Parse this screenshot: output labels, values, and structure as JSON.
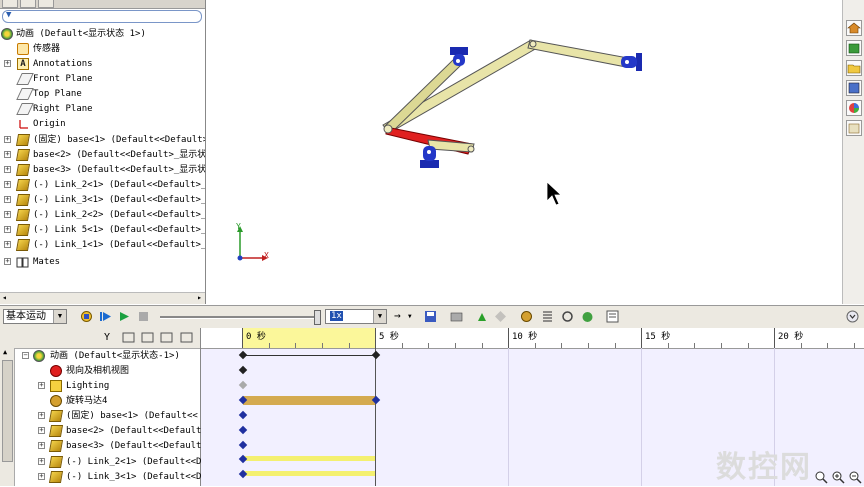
{
  "feature_tree": {
    "root": "动画  (Default<显示状态 1>)",
    "items": [
      {
        "label": "传感器",
        "icon": "sensor-icon"
      },
      {
        "label": "Annotations",
        "icon": "annotations-icon"
      },
      {
        "label": "Front Plane",
        "icon": "plane-icon"
      },
      {
        "label": "Top Plane",
        "icon": "plane-icon"
      },
      {
        "label": "Right Plane",
        "icon": "plane-icon"
      },
      {
        "label": "Origin",
        "icon": "origin-icon"
      },
      {
        "label": "(固定) base<1> (Default<<Default>_",
        "icon": "part-icon"
      },
      {
        "label": "base<2> (Default<<Default>_显示状",
        "icon": "part-icon"
      },
      {
        "label": "base<3> (Default<<Default>_显示状",
        "icon": "part-icon"
      },
      {
        "label": "(-) Link_2<1> (Defaul<<Default>_S",
        "icon": "part-icon"
      },
      {
        "label": "(-) Link_3<1> (Defaul<<Default>_S",
        "icon": "part-icon"
      },
      {
        "label": "(-) Link_2<2> (Defaul<<Default>_S",
        "icon": "part-icon"
      },
      {
        "label": "(-) Link 5<1> (Defaul<<Default>_S",
        "icon": "part-icon"
      },
      {
        "label": "(-) Link_1<1> (Defaul<<Default>_S",
        "icon": "part-icon"
      },
      {
        "label": "Mates",
        "icon": "mates-icon"
      }
    ]
  },
  "motion_toolbar": {
    "study_type": "基本运动",
    "speed": "1x"
  },
  "motion_tree": {
    "items": [
      {
        "label": "动画  (Default<显示状态-1>)"
      },
      {
        "label": "视向及相机视图"
      },
      {
        "label": "Lighting"
      },
      {
        "label": "旋转马达4"
      },
      {
        "label": "(固定) base<1> (Default<<"
      },
      {
        "label": "base<2> (Default<<Default"
      },
      {
        "label": "base<3> (Default<<Default"
      },
      {
        "label": "(-) Link_2<1> (Default<<D"
      },
      {
        "label": "(-) Link_3<1> (Default<<D"
      }
    ]
  },
  "timeline": {
    "labels": [
      "0 秒",
      "5 秒",
      "10 秒",
      "15 秒",
      "20 秒"
    ],
    "colors": {
      "playhead_range": "#fbf79a",
      "motor_bar": "#d4aa50",
      "part_bar": "#f4f070",
      "key": "#2030a0"
    }
  },
  "triad": {
    "x": "X",
    "y": "Y"
  },
  "watermark": "数控网"
}
